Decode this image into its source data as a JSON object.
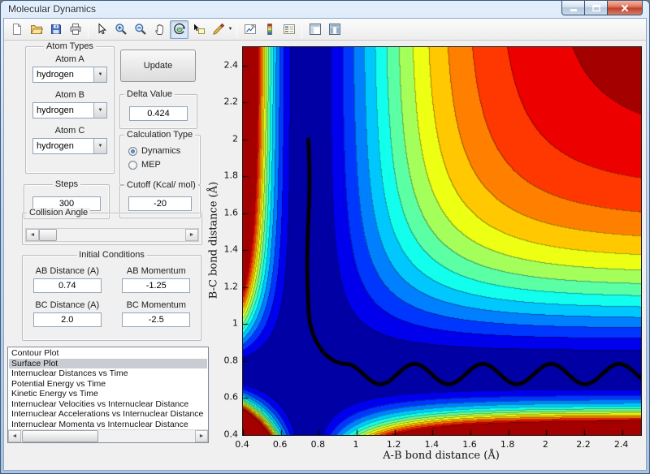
{
  "window": {
    "title": "Molecular Dynamics"
  },
  "toolbar": {
    "items": [
      {
        "name": "new-figure"
      },
      {
        "name": "open-file"
      },
      {
        "name": "save-figure"
      },
      {
        "name": "print-figure"
      },
      {
        "separator": true
      },
      {
        "name": "edit-plot"
      },
      {
        "name": "zoom-in"
      },
      {
        "name": "zoom-out"
      },
      {
        "name": "pan"
      },
      {
        "name": "rotate-3d",
        "pressed": true
      },
      {
        "name": "data-cursor"
      },
      {
        "name": "brush-data",
        "caret": true
      },
      {
        "separator": true
      },
      {
        "name": "link-plot"
      },
      {
        "name": "insert-colorbar"
      },
      {
        "name": "insert-legend"
      },
      {
        "separator": true
      },
      {
        "name": "hide-plot-tools"
      },
      {
        "name": "show-plot-tools"
      }
    ]
  },
  "panels": {
    "atom_types": {
      "title": "Atom Types",
      "fields": [
        {
          "label": "Atom A",
          "value": "hydrogen"
        },
        {
          "label": "Atom B",
          "value": "hydrogen"
        },
        {
          "label": "Atom C",
          "value": "hydrogen"
        }
      ]
    },
    "update": {
      "label": "Update"
    },
    "delta_value": {
      "title": "Delta Value",
      "value": "0.424"
    },
    "calculation_type": {
      "title": "Calculation Type",
      "options": [
        {
          "label": "Dynamics",
          "selected": true
        },
        {
          "label": "MEP",
          "selected": false
        }
      ]
    },
    "steps": {
      "title": "Steps",
      "value": "300"
    },
    "cutoff": {
      "title": "Cutoff (Kcal/ mol)",
      "value": "-20"
    },
    "collision_angle": {
      "title": "Collision Angle"
    },
    "initial_conditions": {
      "title": "Initial Conditions",
      "fields": [
        {
          "label": "AB Distance (A)",
          "value": "0.74"
        },
        {
          "label": "AB Momentum",
          "value": "-1.25"
        },
        {
          "label": "BC Distance (A)",
          "value": "2.0"
        },
        {
          "label": "BC Momentum",
          "value": "-2.5"
        }
      ]
    }
  },
  "plot_list": {
    "items": [
      "Contour Plot",
      "Surface Plot",
      "Internuclear Distances vs Time",
      "Potential Energy vs Time",
      "Kinetic Energy vs Time",
      "Internuclear Velocities vs Internuclear Distance",
      "Internuclear Accelerations vs Internuclear Distance",
      "Internuclear Momenta vs Internuclear Distance"
    ],
    "selected_index": 1
  },
  "chart_data": {
    "type": "heatmap",
    "subtype": "filled-contour",
    "title": "",
    "xlabel": "A-B bond distance (Å)",
    "ylabel": "B-C bond distance (Å)",
    "xlim": [
      0.4,
      2.5
    ],
    "ylim": [
      0.4,
      2.5
    ],
    "xtick_labels": [
      "0.4",
      "0.6",
      "0.8",
      "1",
      "1.2",
      "1.4",
      "1.6",
      "1.8",
      "2",
      "2.2",
      "2.4"
    ],
    "ytick_labels": [
      "0.4",
      "0.6",
      "0.8",
      "1",
      "1.2",
      "1.4",
      "1.6",
      "1.8",
      "2",
      "2.2",
      "2.4"
    ],
    "colormap": "jet",
    "levels": 14,
    "grid": false,
    "surface": {
      "model": "morse-product",
      "r0": 0.74,
      "alpha": 2.6,
      "vmax": 1.0,
      "description": "LEPS-like potential energy surface: low (blue) L-shaped valley along r=0.74 in both bonds, high (dark red) repulsive wall at short distances, red dissociation plateau at large distances"
    },
    "trajectory": {
      "color": "#000000",
      "line_width": 4.6,
      "start": [
        0.745,
        2.0
      ],
      "corner": [
        0.745,
        1.1
      ],
      "channel_y": 0.73,
      "oscillation_amplitude": 0.055,
      "oscillation_wavelength": 0.36,
      "x_end": 2.56
    }
  }
}
